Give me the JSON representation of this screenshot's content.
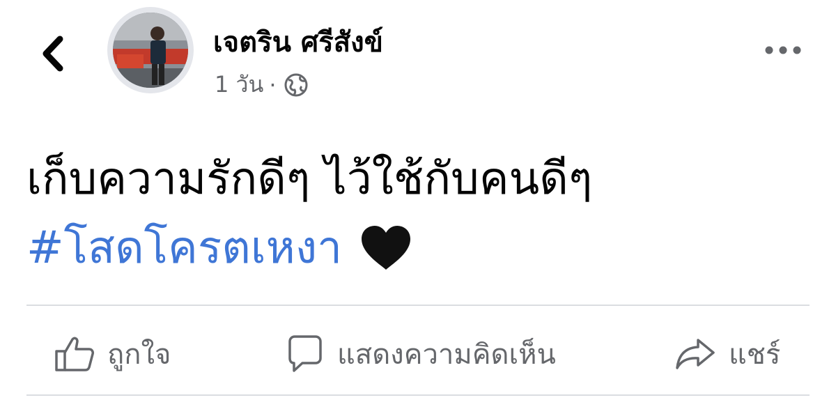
{
  "post": {
    "author": "เจตริน ศรีสังข์",
    "time": "1 วัน",
    "separator": "·",
    "privacy_icon": "globe-icon",
    "text": "เก็บความรักดีๆ ไว้ใช้กับคนดีๆ",
    "hashtag": "#โสดโครตเหงา",
    "emoji_icon": "black-heart-icon"
  },
  "actions": {
    "like_label": "ถูกใจ",
    "comment_label": "แสดงความคิดเห็น",
    "share_label": "แชร์"
  },
  "colors": {
    "hashtag": "#3f76d6",
    "muted": "#65676b",
    "divider": "#dadde1"
  }
}
